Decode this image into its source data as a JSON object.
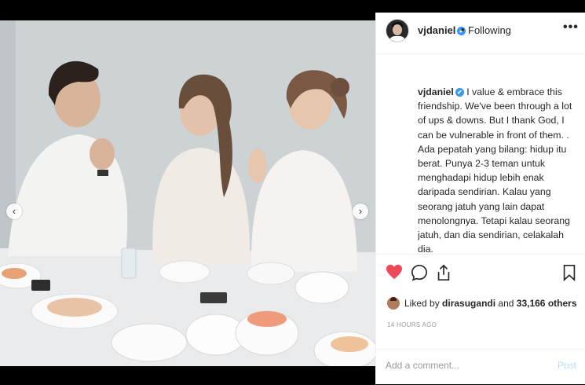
{
  "post": {
    "username": "vjdaniel",
    "verified_mark": "✔",
    "separator": "•",
    "follow_status": "Following",
    "more_label": "•••",
    "caption_user": "vjdaniel",
    "caption_text": "I value & embrace this friendship. We've been through a lot of ups & downs. But I thank God, I can be vulnerable in front of them. . Ada pepatah yang bilang: hidup itu berat. Punya 2-3 teman untuk menghadapi hidup lebih enak daripada sendirian. Kalau yang seorang jatuh yang lain dapat menolongnya. Tetapi kalau seorang jatuh, dan dia sendirian, celakalah dia.",
    "liked_prefix": "Liked by",
    "liked_by_user": "dirasugandi",
    "liked_conjunction": "and",
    "liked_count": "33,166 others",
    "timestamp": "14 HOURS AGO",
    "comment_placeholder": "Add a comment...",
    "post_button": "Post"
  },
  "carousel": {
    "prev_icon": "‹",
    "next_icon": "›"
  },
  "icons": {
    "heart": "heart-icon",
    "comment": "comment-icon",
    "share": "share-icon",
    "bookmark": "bookmark-icon"
  },
  "colors": {
    "like_red": "#ed4956",
    "verified_blue": "#3897f0",
    "post_button_disabled": "#b2dffc"
  }
}
